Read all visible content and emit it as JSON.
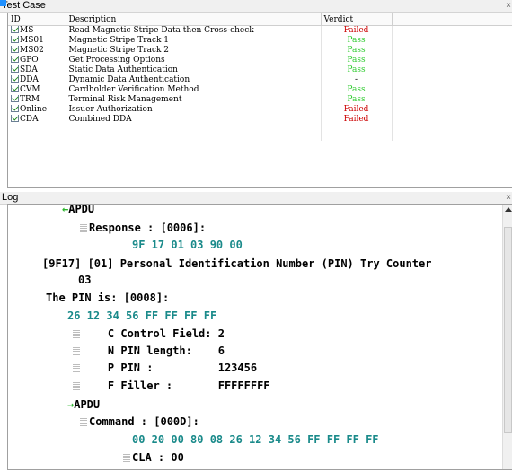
{
  "test_case_panel": {
    "title": "Test Case",
    "close": "×",
    "columns": {
      "id": "ID",
      "description": "Description",
      "verdict": "Verdict"
    },
    "rows": [
      {
        "id": "MS",
        "description": "Read Magnetic Stripe Data then Cross-check",
        "verdict": "Failed",
        "status": "fail"
      },
      {
        "id": "MS01",
        "description": "Magnetic Stripe Track 1",
        "verdict": "Pass",
        "status": "pass"
      },
      {
        "id": "MS02",
        "description": "Magnetic Stripe Track 2",
        "verdict": "Pass",
        "status": "pass"
      },
      {
        "id": "GPO",
        "description": "Get Processing Options",
        "verdict": "Pass",
        "status": "pass"
      },
      {
        "id": "SDA",
        "description": "Static Data Authentication",
        "verdict": "Pass",
        "status": "pass"
      },
      {
        "id": "DDA",
        "description": "Dynamic Data Authentication",
        "verdict": "-",
        "status": "none"
      },
      {
        "id": "CVM",
        "description": "Cardholder Verification Method",
        "verdict": "Pass",
        "status": "pass"
      },
      {
        "id": "TRM",
        "description": "Terminal Risk Management",
        "verdict": "Pass",
        "status": "pass"
      },
      {
        "id": "Online",
        "description": "Issuer Authorization",
        "verdict": "Failed",
        "status": "fail"
      },
      {
        "id": "CDA",
        "description": "Combined DDA",
        "verdict": "Failed",
        "status": "fail"
      }
    ]
  },
  "log_panel": {
    "title": "Log",
    "close": "×",
    "lines": {
      "apdu1": "APDU",
      "response": "Response : [0006]:",
      "response_bytes": "9F 17 01 03 90 00",
      "pin_try": "[9F17] [01] Personal Identification Number (PIN) Try Counter",
      "pin_try_value": "03",
      "pin_is": "The PIN is: [0008]:",
      "pin_bytes": "26 12 34 56 FF FF FF FF",
      "control_field": "C Control Field: 2",
      "pin_length": "N PIN length:    6",
      "pin": "P PIN :          123456",
      "filler": "F Filler :       FFFFFFFF",
      "apdu2": "APDU",
      "command": "Command : [000D]:",
      "command_bytes": "00 20 00 80 08 26 12 34 56 FF FF FF FF",
      "cla": "CLA : 00"
    }
  },
  "colors": {
    "fail": "#cc0000",
    "pass": "#33cc33",
    "hex_bytes": "#1a8a8a",
    "arrow": "#2db52d",
    "marker": "#1e90ff"
  }
}
